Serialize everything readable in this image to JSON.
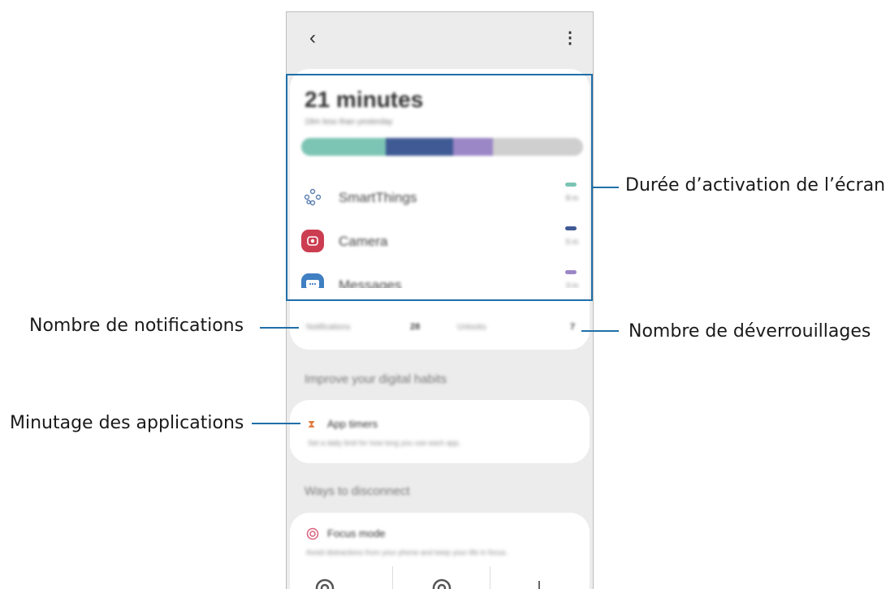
{
  "callouts": {
    "screen_time": "Durée d’activation de l’écran",
    "notifications": "Nombre de notifications",
    "unlocks": "Nombre de déverrouillages",
    "app_timers": "Minutage des applications"
  },
  "header": {
    "back_icon": "chevron-left-icon",
    "more_icon": "more-vertical-icon"
  },
  "summary": {
    "total": "21 minutes",
    "comparison": "19m less than yesterday",
    "segments": [
      {
        "app": "SmartThings",
        "fraction": 0.3,
        "color": "#7cc5b4"
      },
      {
        "app": "Camera",
        "fraction": 0.24,
        "color": "#3f5a94"
      },
      {
        "app": "Messages",
        "fraction": 0.14,
        "color": "#9b86c6"
      },
      {
        "app": "Other",
        "fraction": 0.32,
        "color": "#cfcfcf"
      }
    ],
    "apps": [
      {
        "name": "SmartThings",
        "time": "8 m",
        "icon": "smartthings-icon",
        "icon_color": "#5a7fb0",
        "dash_color": "#7cc5b4"
      },
      {
        "name": "Camera",
        "time": "5 m",
        "icon": "camera-icon",
        "icon_color": "#cc3d51",
        "dash_color": "#3f5a94"
      },
      {
        "name": "Messages",
        "time": "3 m",
        "icon": "messages-icon",
        "icon_color": "#3f7fc2",
        "dash_color": "#9b86c6"
      }
    ]
  },
  "stats": {
    "notifications_label": "Notifications",
    "notifications_value": "28",
    "unlocks_label": "Unlocks",
    "unlocks_value": "7"
  },
  "habits": {
    "section_title": "Improve your digital habits",
    "app_timers_title": "App timers",
    "app_timers_desc": "Set a daily limit for how long you use each app.",
    "icon": "hourglass-icon",
    "icon_color": "#e07a3c"
  },
  "disconnect": {
    "section_title": "Ways to disconnect",
    "focus_title": "Focus mode",
    "focus_desc": "Avoid distractions from your phone and keep your life in focus.",
    "icon": "target-icon",
    "icon_color": "#d9607d"
  }
}
